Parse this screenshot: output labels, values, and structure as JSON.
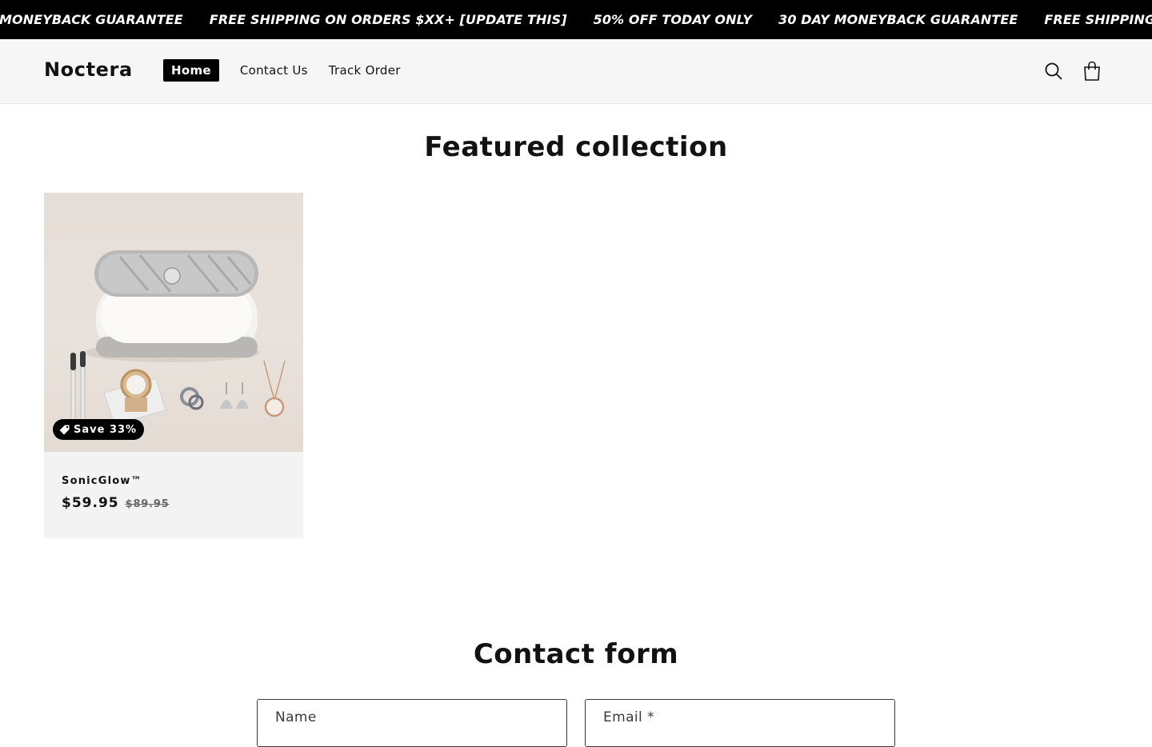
{
  "announcement": {
    "items": [
      "MONEYBACK GUARANTEE",
      "FREE SHIPPING ON ORDERS $XX+ [UPDATE THIS]",
      "50% OFF TODAY ONLY",
      "30 DAY MONEYBACK GUARANTEE",
      "FREE SHIPPING ON O"
    ]
  },
  "header": {
    "logo": "Noctera",
    "nav": [
      {
        "label": "Home",
        "active": true
      },
      {
        "label": "Contact Us",
        "active": false
      },
      {
        "label": "Track Order",
        "active": false
      }
    ],
    "icons": [
      "search-icon",
      "cart-icon"
    ]
  },
  "featured": {
    "title": "Featured collection",
    "products": [
      {
        "name": "SonicGlow™",
        "badge": "Save 33%",
        "price": "$59.95",
        "compare_price": "$89.95"
      }
    ]
  },
  "contact": {
    "title": "Contact form",
    "name_label": "Name",
    "email_label": "Email *"
  },
  "colors": {
    "announcement_bg": "#000000",
    "header_bg": "#f6f6f6",
    "card_bg": "#f3f3f3",
    "badge_bg": "#000000"
  }
}
